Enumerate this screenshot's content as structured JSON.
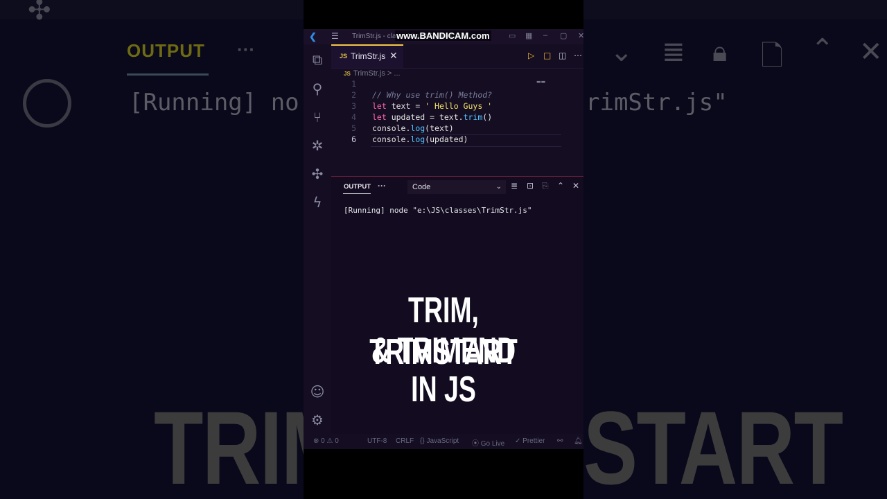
{
  "background": {
    "tab_label": "OUTPUT",
    "tab_dots": "···",
    "running_text_left": "[Running] no",
    "running_text_right": "rimStr.js\"",
    "big_text_left": "TRIM",
    "big_text_right": "START"
  },
  "watermark": "www.BANDICAM.com",
  "titlebar": {
    "title": "TrimStr.js - cla... - Visual Studio Co...",
    "menu_icon": "hamburger-menu-icon",
    "app_icon": "vscode-logo-icon"
  },
  "activity_bar": {
    "items": [
      "files-icon",
      "search-icon",
      "source-control-icon",
      "debug-icon",
      "extensions-icon",
      "lightning-icon"
    ],
    "bottom": [
      "account-icon",
      "gear-icon"
    ]
  },
  "tab": {
    "badge": "JS",
    "label": "TrimStr.js",
    "close": "✕"
  },
  "breadcrumb": {
    "badge": "JS",
    "file": "TrimStr.js",
    "sep": ">",
    "rest": "..."
  },
  "editor": {
    "lines": [
      {
        "n": "1",
        "text": ""
      },
      {
        "n": "2",
        "text": "// Why use trim() Method?"
      },
      {
        "n": "3",
        "kw": "let",
        "ident": " text = ",
        "str": "' Hello Guys '"
      },
      {
        "n": "4",
        "kw": "let",
        "ident": " updated = text.",
        "fn": "trim",
        "tail": "()"
      },
      {
        "n": "5",
        "pre": "console.",
        "fn": "log",
        "tail": "(text)"
      },
      {
        "n": "6",
        "pre": "console.",
        "fn": "log",
        "tail": "(updated)"
      }
    ]
  },
  "panel": {
    "tab": "OUTPUT",
    "dots": "···",
    "select_value": "Code",
    "output": "[Running] node \"e:\\JS\\classes\\TrimStr.js\""
  },
  "statusbar": {
    "errors": "0",
    "warnings": "0",
    "encoding": "UTF-8",
    "eol": "CRLF",
    "language": "JavaScript",
    "golive": "Go Live",
    "prettier": "Prettier"
  },
  "overlay": {
    "line1": "TRIM, TRIMSTART",
    "line2": "& TRIMEND",
    "line3": "IN JS"
  }
}
